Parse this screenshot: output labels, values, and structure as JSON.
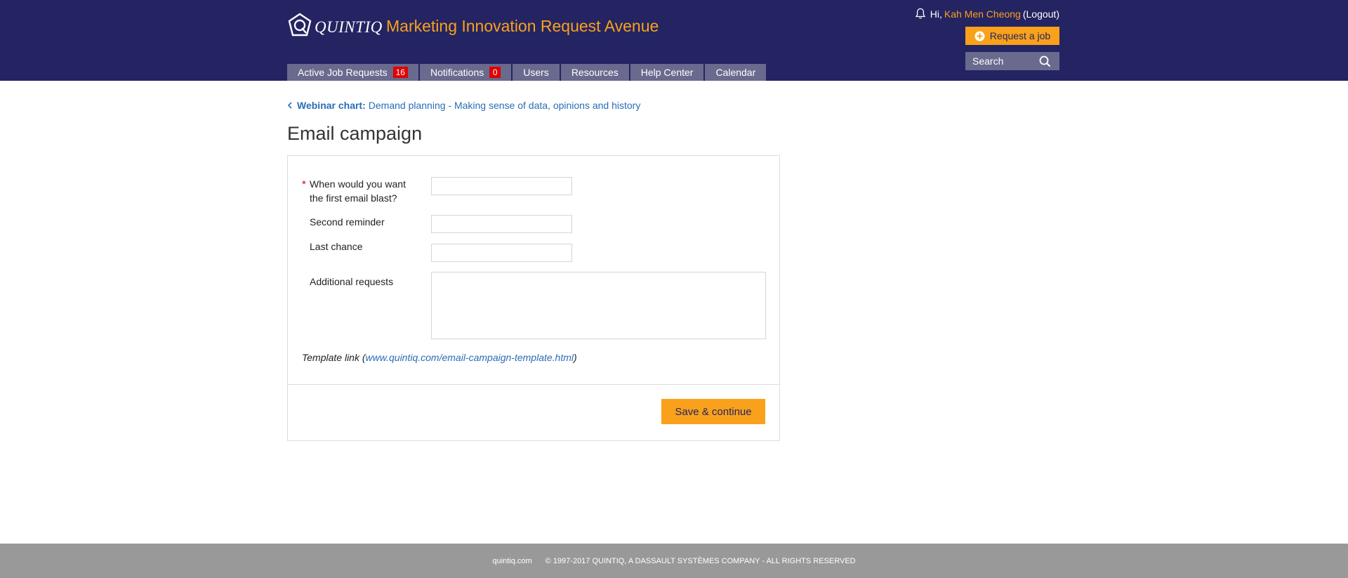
{
  "header": {
    "logo_text": "QUINTIQ",
    "app_title": "Marketing Innovation Request Avenue",
    "greeting": "Hi,",
    "user_name": "Kah Men Cheong",
    "logout": "(Logout)",
    "request_button": "Request a job",
    "search_placeholder": "Search",
    "accent_color": "#f9a11b",
    "background_color": "#242463"
  },
  "nav": {
    "tabs": [
      {
        "label": "Active Job Requests",
        "badge": "16"
      },
      {
        "label": "Notifications",
        "badge": "0"
      },
      {
        "label": "Users"
      },
      {
        "label": "Resources"
      },
      {
        "label": "Help Center"
      },
      {
        "label": "Calendar"
      }
    ]
  },
  "breadcrumb": {
    "parent_label": "Webinar chart:",
    "parent_title": "Demand planning - Making sense of data, opinions and history"
  },
  "page": {
    "title": "Email campaign"
  },
  "form": {
    "required_marker": "*",
    "fields": [
      {
        "label_line1": "When would you want",
        "label_line2": "the first email blast?",
        "value": "",
        "required": true
      },
      {
        "label": "Second reminder",
        "value": ""
      },
      {
        "label": "Last chance",
        "value": ""
      },
      {
        "label": "Additional requests",
        "value": ""
      }
    ],
    "template_label": "Template link",
    "template_open": "(",
    "template_url": "www.quintiq.com/email-campaign-template.html",
    "template_close": ")",
    "save_button": "Save & continue"
  },
  "footer": {
    "site": "quintiq.com",
    "copyright": "© 1997-2017 QUINTIQ, A DASSAULT SYSTÈMES COMPANY - ALL RIGHTS RESERVED"
  },
  "icons": {
    "logo": "quintiq-logo-icon",
    "bell": "bell-icon",
    "plus": "plus-circle-icon",
    "search": "search-icon",
    "chevron": "chevron-left-icon"
  }
}
